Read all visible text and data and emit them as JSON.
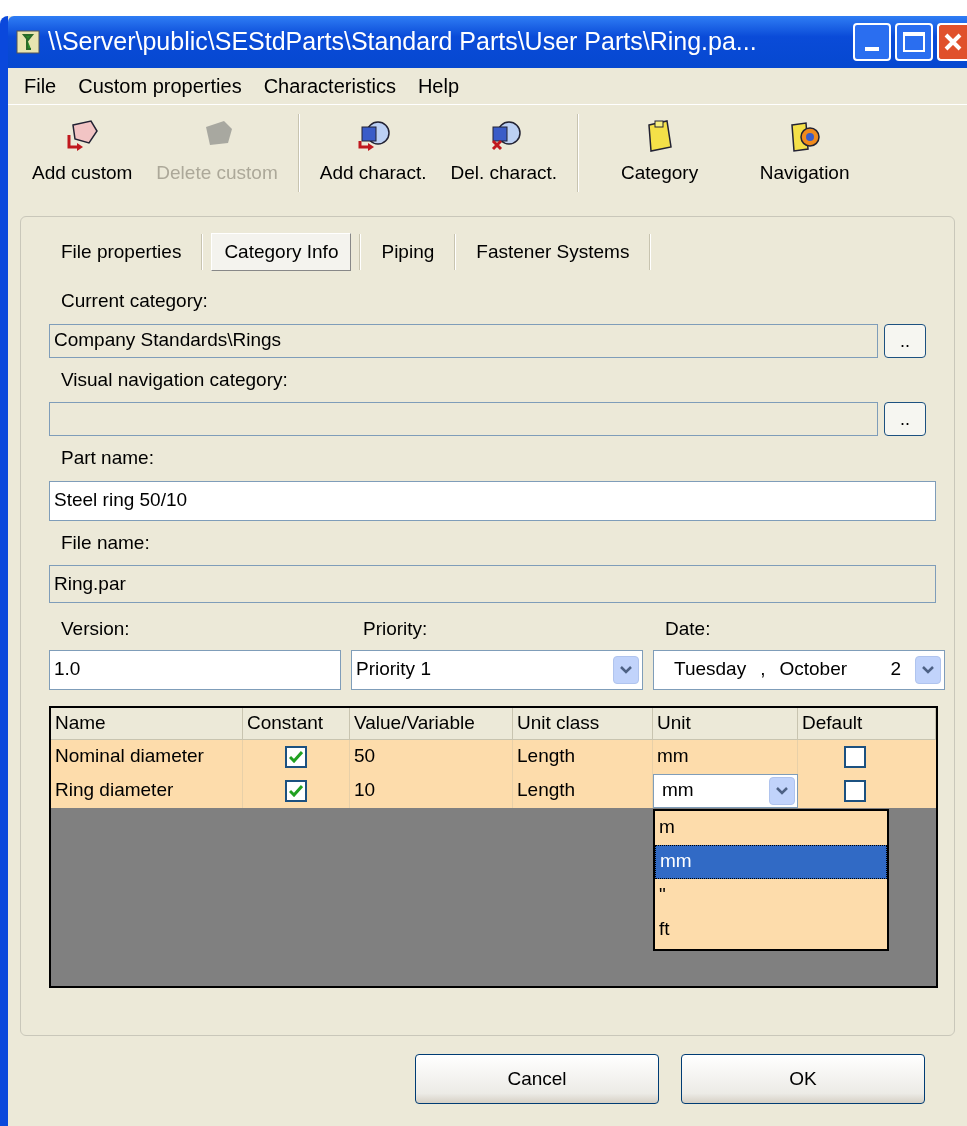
{
  "window": {
    "title": "\\\\Server\\public\\SEStdParts\\Standard Parts\\User Parts\\Ring.pa..."
  },
  "menu": [
    "File",
    "Custom properties",
    "Characteristics",
    "Help"
  ],
  "toolbar": [
    {
      "label": "Add custom",
      "kind": "add-custom",
      "disabled": false
    },
    {
      "label": "Delete custom",
      "kind": "delete-custom",
      "disabled": true
    },
    {
      "label": "Add charact.",
      "kind": "add-charact",
      "disabled": false
    },
    {
      "label": "Del. charact.",
      "kind": "del-charact",
      "disabled": false
    },
    {
      "label": "Category",
      "kind": "category",
      "disabled": false
    },
    {
      "label": "Navigation",
      "kind": "navigation",
      "disabled": false
    }
  ],
  "tabs": [
    {
      "label": "File properties",
      "selected": false
    },
    {
      "label": "Category Info",
      "selected": true
    },
    {
      "label": "Piping",
      "selected": false
    },
    {
      "label": "Fastener Systems",
      "selected": false
    }
  ],
  "current_category": {
    "label": "Current category:",
    "value": "Company Standards\\Rings",
    "browse": ".."
  },
  "visual_navigation_category": {
    "label": "Visual navigation category:",
    "browse": ".."
  },
  "part_name": {
    "label": "Part name:",
    "value": "Steel ring 50/10"
  },
  "file_name": {
    "label": "File name:",
    "value": "Ring.par"
  },
  "version": {
    "label": "Version:",
    "value": "1.0"
  },
  "priority": {
    "label": "Priority:",
    "value": "Priority 1"
  },
  "date": {
    "label": "Date:",
    "weekday": "Tuesday",
    "separator": ",",
    "month": "October",
    "day": "2"
  },
  "table": {
    "columns": [
      "Name",
      "Constant",
      "Value/Variable",
      "Unit class",
      "Unit",
      "Default"
    ],
    "rows": [
      {
        "name": "Nominal diameter",
        "constant": true,
        "value": "50",
        "unit_class": "Length",
        "unit": "mm",
        "default": false,
        "editing": false
      },
      {
        "name": "Ring diameter",
        "constant": true,
        "value": "10",
        "unit_class": "Length",
        "unit": "mm",
        "default": false,
        "editing": true
      }
    ]
  },
  "unit_dropdown": [
    {
      "label": "m",
      "selected": false
    },
    {
      "label": "mm",
      "selected": true
    },
    {
      "label": "\"",
      "selected": false
    },
    {
      "label": "ft",
      "selected": false
    }
  ],
  "buttons": [
    "Cancel",
    "OK"
  ]
}
